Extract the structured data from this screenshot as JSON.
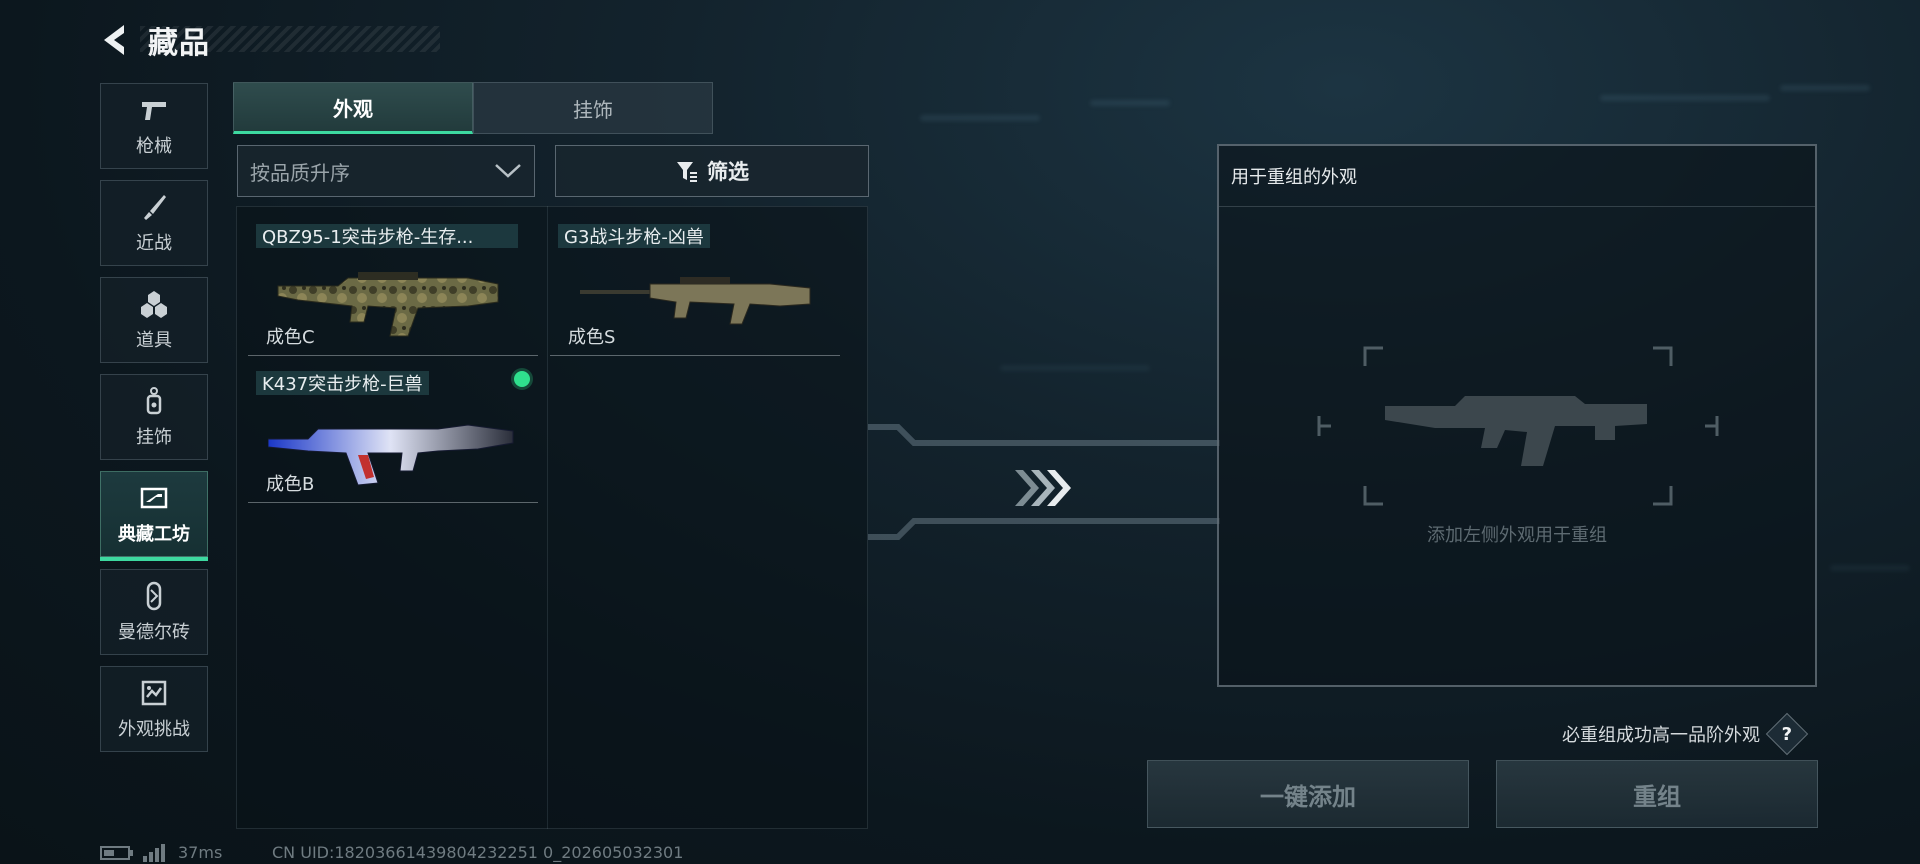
{
  "header": {
    "title": "藏品"
  },
  "sidebar": {
    "items": [
      {
        "label": "枪械",
        "icon": "pistol-icon"
      },
      {
        "label": "近战",
        "icon": "knife-icon"
      },
      {
        "label": "道具",
        "icon": "grenade-cluster-icon"
      },
      {
        "label": "挂饰",
        "icon": "charm-tag-icon"
      },
      {
        "label": "典藏工坊",
        "icon": "workshop-icon",
        "active": true
      },
      {
        "label": "曼德尔砖",
        "icon": "brick-capsule-icon"
      },
      {
        "label": "外观挑战",
        "icon": "challenge-card-icon"
      }
    ]
  },
  "tabs": [
    {
      "label": "外观",
      "active": true
    },
    {
      "label": "挂饰",
      "active": false
    }
  ],
  "toolbar": {
    "sort_label": "按品质升序",
    "filter_label": "筛选"
  },
  "items": [
    {
      "name": "QBZ95-1突击步枪-生存...",
      "grade": "成色C",
      "selected": false
    },
    {
      "name": "G3战斗步枪-凶兽",
      "grade": "成色S",
      "selected": false
    },
    {
      "name": "K437突击步枪-巨兽",
      "grade": "成色B",
      "selected": true
    }
  ],
  "panel": {
    "title": "用于重组的外观",
    "placeholder": "添加左侧外观用于重组"
  },
  "hint": {
    "text": "必重组成功高一品阶外观",
    "help": "?"
  },
  "buttons": {
    "add_all": "一键添加",
    "recompose": "重组"
  },
  "status": {
    "ping": "37ms",
    "uid": "CN UID:18203661439804232251 0_202605032301"
  },
  "colors": {
    "accent": "#3dd9a0",
    "selected_dot": "#2fe08d"
  }
}
